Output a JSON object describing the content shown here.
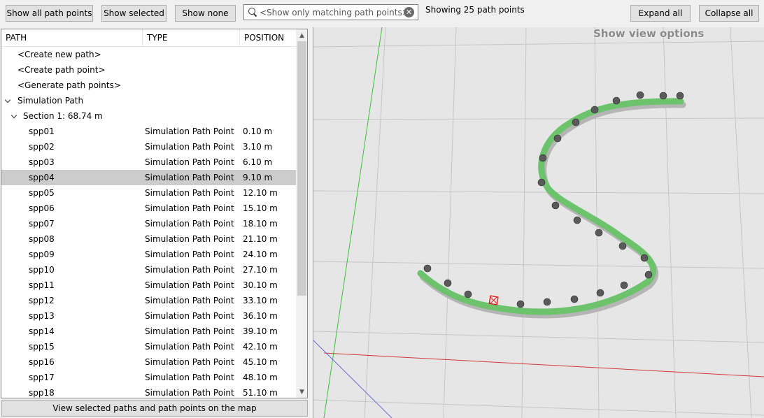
{
  "toolbar": {
    "show_all": "Show all path points",
    "show_selected": "Show selected",
    "show_none": "Show none",
    "search_placeholder": "<Show only matching path points>",
    "status": "Showing 25 path points",
    "expand_all": "Expand all",
    "collapse_all": "Collapse all"
  },
  "tree": {
    "columns": {
      "path": "PATH",
      "type": "TYPE",
      "position": "POSITION"
    },
    "actions": [
      "<Create new path>",
      "<Create path point>",
      "<Generate path points>"
    ],
    "path_name": "Simulation Path",
    "section_label": "Section 1: 68.74 m",
    "points": [
      {
        "name": "spp01",
        "type": "Simulation Path Point",
        "position": "0.10 m"
      },
      {
        "name": "spp02",
        "type": "Simulation Path Point",
        "position": "3.10 m"
      },
      {
        "name": "spp03",
        "type": "Simulation Path Point",
        "position": "6.10 m"
      },
      {
        "name": "spp04",
        "type": "Simulation Path Point",
        "position": "9.10 m",
        "selected": true
      },
      {
        "name": "spp05",
        "type": "Simulation Path Point",
        "position": "12.10 m"
      },
      {
        "name": "spp06",
        "type": "Simulation Path Point",
        "position": "15.10 m"
      },
      {
        "name": "spp07",
        "type": "Simulation Path Point",
        "position": "18.10 m"
      },
      {
        "name": "spp08",
        "type": "Simulation Path Point",
        "position": "21.10 m"
      },
      {
        "name": "spp09",
        "type": "Simulation Path Point",
        "position": "24.10 m"
      },
      {
        "name": "spp10",
        "type": "Simulation Path Point",
        "position": "27.10 m"
      },
      {
        "name": "spp11",
        "type": "Simulation Path Point",
        "position": "30.10 m"
      },
      {
        "name": "spp12",
        "type": "Simulation Path Point",
        "position": "33.10 m"
      },
      {
        "name": "spp13",
        "type": "Simulation Path Point",
        "position": "36.10 m"
      },
      {
        "name": "spp14",
        "type": "Simulation Path Point",
        "position": "39.10 m"
      },
      {
        "name": "spp15",
        "type": "Simulation Path Point",
        "position": "42.10 m"
      },
      {
        "name": "spp16",
        "type": "Simulation Path Point",
        "position": "45.10 m"
      },
      {
        "name": "spp17",
        "type": "Simulation Path Point",
        "position": "48.10 m"
      },
      {
        "name": "spp18",
        "type": "Simulation Path Point",
        "position": "51.10 m"
      }
    ]
  },
  "bottom_button": "View selected paths and path points on the map",
  "viewport": {
    "view_options": "Show view options"
  },
  "colors": {
    "path_green": "#6cc36c",
    "selection_gray": "#cccccc",
    "axis_red": "#d23a3a",
    "axis_green": "#3bbf3b",
    "axis_blue": "#6a6ad8"
  }
}
